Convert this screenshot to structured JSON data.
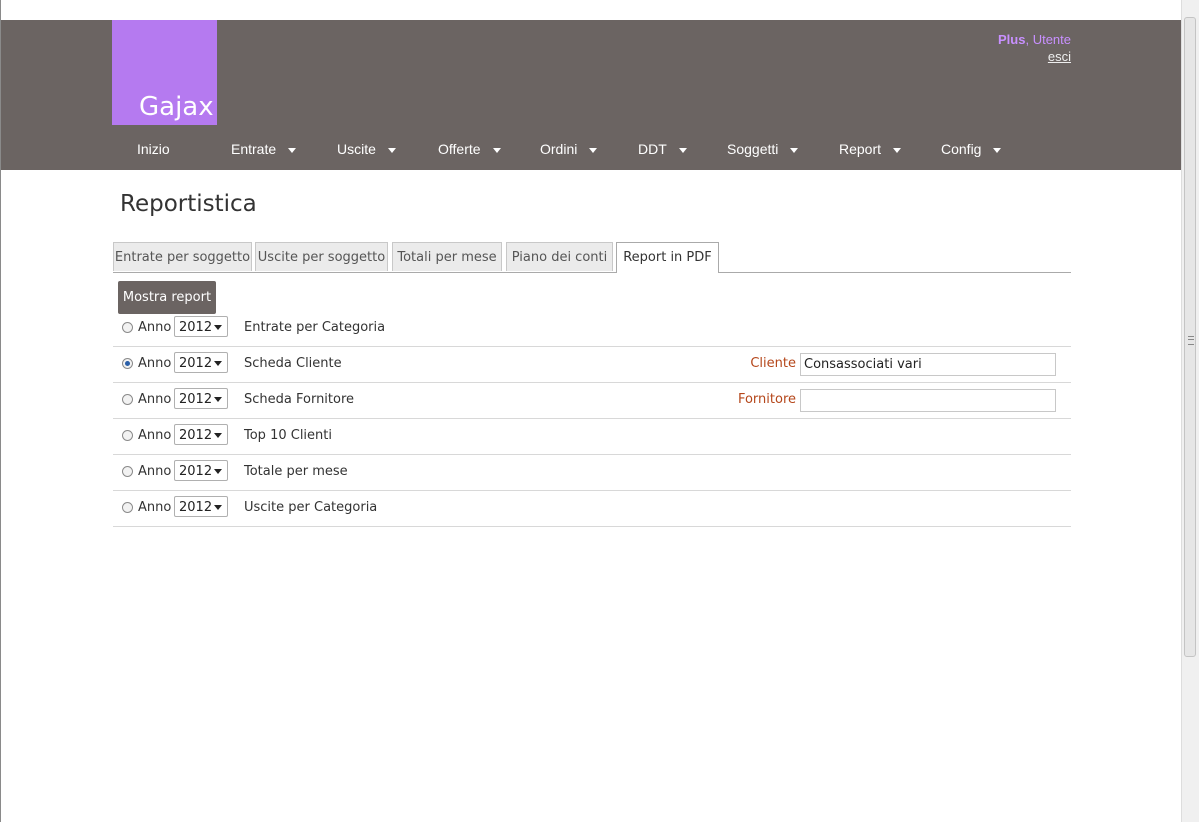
{
  "app": {
    "logo_text": "Gajax"
  },
  "user": {
    "plan": "Plus",
    "separator": ",",
    "name": "Utente",
    "logout": "esci"
  },
  "nav": [
    {
      "label": "Inizio",
      "dropdown": false
    },
    {
      "label": "Entrate",
      "dropdown": true
    },
    {
      "label": "Uscite",
      "dropdown": true
    },
    {
      "label": "Offerte",
      "dropdown": true
    },
    {
      "label": "Ordini",
      "dropdown": true
    },
    {
      "label": "DDT",
      "dropdown": true
    },
    {
      "label": "Soggetti",
      "dropdown": true
    },
    {
      "label": "Report",
      "dropdown": true
    },
    {
      "label": "Config",
      "dropdown": true
    }
  ],
  "page": {
    "title": "Reportistica"
  },
  "tabs": [
    {
      "label": "Entrate per soggetto",
      "active": false
    },
    {
      "label": "Uscite per soggetto",
      "active": false
    },
    {
      "label": "Totali per mese",
      "active": false
    },
    {
      "label": "Piano dei conti",
      "active": false
    },
    {
      "label": "Report in PDF",
      "active": true
    }
  ],
  "actions": {
    "show_report": "Mostra report"
  },
  "reports": [
    {
      "year_label": "Anno",
      "year": "2012",
      "name": "Entrate per Categoria",
      "selected": false
    },
    {
      "year_label": "Anno",
      "year": "2012",
      "name": "Scheda Cliente",
      "selected": true,
      "field": {
        "label": "Cliente",
        "value": "Consassociati vari"
      }
    },
    {
      "year_label": "Anno",
      "year": "2012",
      "name": "Scheda Fornitore",
      "selected": false,
      "field": {
        "label": "Fornitore",
        "value": ""
      }
    },
    {
      "year_label": "Anno",
      "year": "2012",
      "name": "Top 10 Clienti",
      "selected": false
    },
    {
      "year_label": "Anno",
      "year": "2012",
      "name": "Totale per mese",
      "selected": false
    },
    {
      "year_label": "Anno",
      "year": "2012",
      "name": "Uscite per Categoria",
      "selected": false
    }
  ],
  "colors": {
    "header_bg": "#6b6462",
    "accent": "#b57af0",
    "field_label": "#b5471b"
  }
}
